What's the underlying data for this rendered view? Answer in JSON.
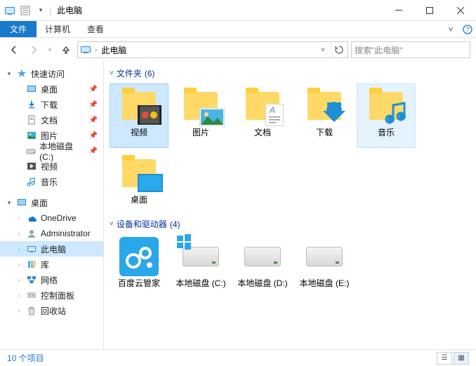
{
  "titlebar": {
    "title": "此电脑"
  },
  "ribbon": {
    "file": "文件",
    "tabs": [
      "计算机",
      "查看"
    ]
  },
  "address": {
    "crumb": "此电脑"
  },
  "search": {
    "placeholder": "搜索\"此电脑\""
  },
  "sidebar": {
    "quick": {
      "label": "快速访问",
      "items": [
        {
          "label": "桌面",
          "icon": "desktop",
          "pinned": true
        },
        {
          "label": "下载",
          "icon": "download",
          "pinned": true
        },
        {
          "label": "文档",
          "icon": "doc",
          "pinned": true
        },
        {
          "label": "图片",
          "icon": "pic",
          "pinned": true
        },
        {
          "label": "本地磁盘 (C:)",
          "icon": "drive",
          "pinned": true
        },
        {
          "label": "视频",
          "icon": "video",
          "pinned": false
        },
        {
          "label": "音乐",
          "icon": "music",
          "pinned": false
        }
      ]
    },
    "desktop": {
      "label": "桌面",
      "items": [
        {
          "label": "OneDrive",
          "icon": "onedrive"
        },
        {
          "label": "Administrator",
          "icon": "user"
        },
        {
          "label": "此电脑",
          "icon": "pc",
          "selected": true
        },
        {
          "label": "库",
          "icon": "lib"
        },
        {
          "label": "网络",
          "icon": "net"
        },
        {
          "label": "控制面板",
          "icon": "cpl"
        },
        {
          "label": "回收站",
          "icon": "bin"
        }
      ]
    }
  },
  "groups": {
    "folders": {
      "title": "文件夹",
      "count": 6,
      "items": [
        {
          "label": "视频",
          "kind": "video",
          "selected": true
        },
        {
          "label": "图片",
          "kind": "pic"
        },
        {
          "label": "文档",
          "kind": "doc"
        },
        {
          "label": "下载",
          "kind": "download"
        },
        {
          "label": "音乐",
          "kind": "music",
          "hover": true
        },
        {
          "label": "桌面",
          "kind": "desktop"
        }
      ]
    },
    "drives": {
      "title": "设备和驱动器",
      "count": 4,
      "items": [
        {
          "label": "百度云管家",
          "kind": "baidu"
        },
        {
          "label": "本地磁盘 (C:)",
          "kind": "sysdrive"
        },
        {
          "label": "本地磁盘 (D:)",
          "kind": "drive"
        },
        {
          "label": "本地磁盘 (E:)",
          "kind": "drive"
        }
      ]
    }
  },
  "status": {
    "text": "10 个项目"
  }
}
